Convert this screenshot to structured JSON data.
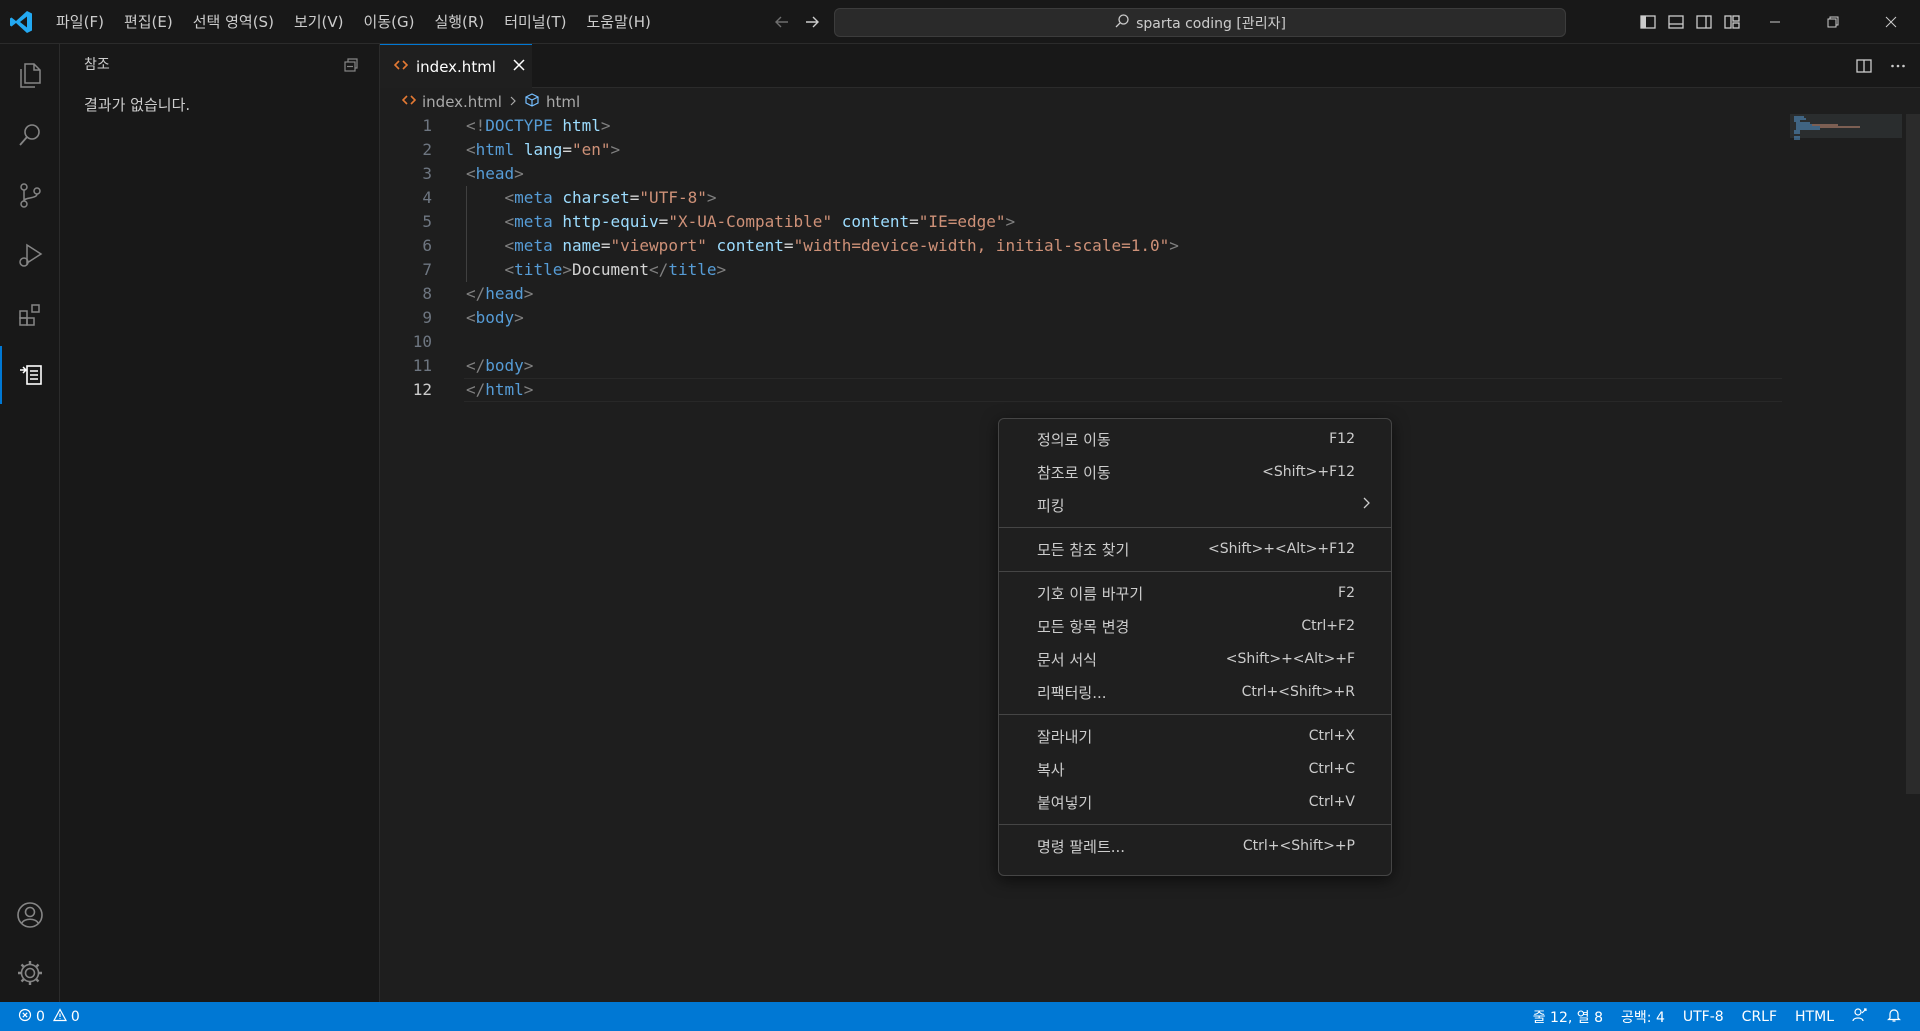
{
  "menu": [
    "파일(F)",
    "편집(E)",
    "선택 영역(S)",
    "보기(V)",
    "이동(G)",
    "실행(R)",
    "터미널(T)",
    "도움말(H)"
  ],
  "command_center": {
    "text": "sparta coding [관리자]"
  },
  "sidebar": {
    "title": "참조",
    "empty_message": "결과가 없습니다."
  },
  "tab": {
    "label": "index.html"
  },
  "breadcrumb": {
    "file": "index.html",
    "symbol": "html"
  },
  "editor": {
    "current_line": 12,
    "lines": [
      {
        "n": "1",
        "tokens": [
          [
            "t",
            "<!"
          ],
          [
            "tn",
            "DOCTYPE"
          ],
          [
            "tx",
            " "
          ],
          [
            "an",
            "html"
          ],
          [
            "t",
            ">"
          ]
        ]
      },
      {
        "n": "2",
        "tokens": [
          [
            "t",
            "<"
          ],
          [
            "tn",
            "html"
          ],
          [
            "tx",
            " "
          ],
          [
            "an",
            "lang"
          ],
          [
            "eq",
            "="
          ],
          [
            "av",
            "\"en\""
          ],
          [
            "t",
            ">"
          ]
        ]
      },
      {
        "n": "3",
        "tokens": [
          [
            "t",
            "<"
          ],
          [
            "tn",
            "head"
          ],
          [
            "t",
            ">"
          ]
        ]
      },
      {
        "n": "4",
        "indent": true,
        "tokens": [
          [
            "tx",
            "    "
          ],
          [
            "t",
            "<"
          ],
          [
            "tn",
            "meta"
          ],
          [
            "tx",
            " "
          ],
          [
            "an",
            "charset"
          ],
          [
            "eq",
            "="
          ],
          [
            "av",
            "\"UTF-8\""
          ],
          [
            "t",
            ">"
          ]
        ]
      },
      {
        "n": "5",
        "indent": true,
        "tokens": [
          [
            "tx",
            "    "
          ],
          [
            "t",
            "<"
          ],
          [
            "tn",
            "meta"
          ],
          [
            "tx",
            " "
          ],
          [
            "an",
            "http-equiv"
          ],
          [
            "eq",
            "="
          ],
          [
            "av",
            "\"X-UA-Compatible\""
          ],
          [
            "tx",
            " "
          ],
          [
            "an",
            "content"
          ],
          [
            "eq",
            "="
          ],
          [
            "av",
            "\"IE=edge\""
          ],
          [
            "t",
            ">"
          ]
        ]
      },
      {
        "n": "6",
        "indent": true,
        "tokens": [
          [
            "tx",
            "    "
          ],
          [
            "t",
            "<"
          ],
          [
            "tn",
            "meta"
          ],
          [
            "tx",
            " "
          ],
          [
            "an",
            "name"
          ],
          [
            "eq",
            "="
          ],
          [
            "av",
            "\"viewport\""
          ],
          [
            "tx",
            " "
          ],
          [
            "an",
            "content"
          ],
          [
            "eq",
            "="
          ],
          [
            "av",
            "\"width=device-width, initial-scale=1.0\""
          ],
          [
            "t",
            ">"
          ]
        ]
      },
      {
        "n": "7",
        "indent": true,
        "tokens": [
          [
            "tx",
            "    "
          ],
          [
            "t",
            "<"
          ],
          [
            "tn",
            "title"
          ],
          [
            "t",
            ">"
          ],
          [
            "tx",
            "Document"
          ],
          [
            "t",
            "</"
          ],
          [
            "tn",
            "title"
          ],
          [
            "t",
            ">"
          ]
        ]
      },
      {
        "n": "8",
        "tokens": [
          [
            "t",
            "</"
          ],
          [
            "tn",
            "head"
          ],
          [
            "t",
            ">"
          ]
        ]
      },
      {
        "n": "9",
        "tokens": [
          [
            "t",
            "<"
          ],
          [
            "tn",
            "body"
          ],
          [
            "t",
            ">"
          ]
        ]
      },
      {
        "n": "10",
        "tokens": []
      },
      {
        "n": "11",
        "tokens": [
          [
            "t",
            "</"
          ],
          [
            "tn",
            "body"
          ],
          [
            "t",
            ">"
          ]
        ]
      },
      {
        "n": "12",
        "tokens": [
          [
            "t",
            "</"
          ],
          [
            "tn",
            "html"
          ],
          [
            "t",
            ">"
          ]
        ]
      }
    ]
  },
  "context_menu": {
    "groups": [
      [
        {
          "label": "정의로 이동",
          "shortcut": "F12"
        },
        {
          "label": "참조로 이동",
          "shortcut": "<Shift>+F12"
        },
        {
          "label": "피킹",
          "submenu": true
        }
      ],
      [
        {
          "label": "모든 참조 찾기",
          "shortcut": "<Shift>+<Alt>+F12"
        }
      ],
      [
        {
          "label": "기호 이름 바꾸기",
          "shortcut": "F2"
        },
        {
          "label": "모든 항목 변경",
          "shortcut": "Ctrl+F2"
        },
        {
          "label": "문서 서식",
          "shortcut": "<Shift>+<Alt>+F"
        },
        {
          "label": "리팩터링...",
          "shortcut": "Ctrl+<Shift>+R"
        }
      ],
      [
        {
          "label": "잘라내기",
          "shortcut": "Ctrl+X"
        },
        {
          "label": "복사",
          "shortcut": "Ctrl+C"
        },
        {
          "label": "붙여넣기",
          "shortcut": "Ctrl+V"
        }
      ],
      [
        {
          "label": "명령 팔레트...",
          "shortcut": "Ctrl+<Shift>+P"
        }
      ]
    ]
  },
  "status": {
    "errors": "0",
    "warnings": "0",
    "position": "줄 12, 열 8",
    "spaces": "공백: 4",
    "encoding": "UTF-8",
    "eol": "CRLF",
    "language": "HTML"
  },
  "colors": {
    "accent": "#0078d4",
    "statusbar": "#0078d4",
    "tag": "#569cd6",
    "attr": "#9cdcfe",
    "string": "#ce9178"
  }
}
